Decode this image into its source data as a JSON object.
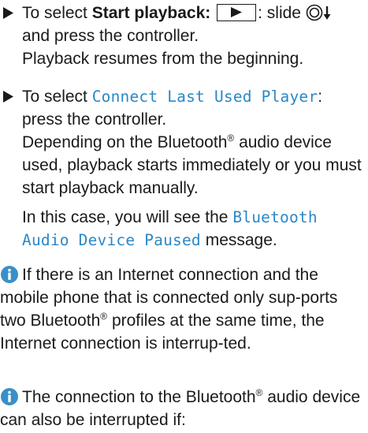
{
  "instructions": [
    {
      "prefix": "To select ",
      "bold_label": "Start playback:",
      "after_key": ": slide ",
      "after_ctrl": "and press the controller.",
      "result": "Playback resumes from the beginning."
    },
    {
      "prefix": "To select ",
      "display_text": "Connect Last Used Player",
      "after_display": ":",
      "line2": "press the controller.",
      "para2_before": "Depending on the Bluetooth",
      "para2_after": " audio device used, playback starts immediately or you must start playback manually.",
      "para3_before": "In this case, you will see the ",
      "para3_display": "Bluetooth Audio Device Paused",
      "para3_after": " message."
    }
  ],
  "notes": [
    {
      "before": "If there is an Internet connection and the mobile phone that is connected only sup-ports two Bluetooth",
      "after": " profiles at the same time, the Internet connection is interrup-ted."
    },
    {
      "before": "The connection to the Bluetooth",
      "after": " audio device can also be interrupted if:"
    }
  ],
  "symbols": {
    "registered": "®",
    "bullet_icon": "triangle-bullet-icon",
    "info_icon": "info-icon",
    "play_icon": "play-icon",
    "controller_icon": "controller-slide-down-icon"
  },
  "colors": {
    "display_text": "#2a88c6",
    "info_icon": "#3a8fc8",
    "text": "#1a1a1a"
  }
}
